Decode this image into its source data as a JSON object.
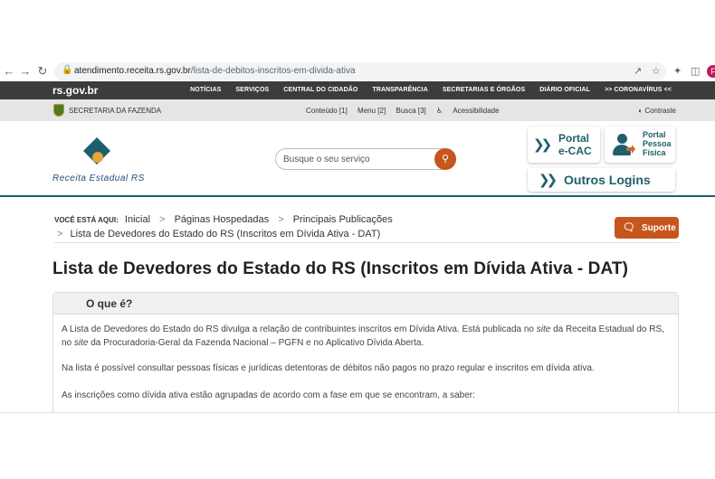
{
  "browser": {
    "back_icon": "←",
    "forward_icon": "→",
    "reload_icon": "↻",
    "url_domain": "atendimento.receita.rs.gov.br",
    "url_path": "/lista-de-debitos-inscritos-em-divida-ativa",
    "profile_letter": "F"
  },
  "topnav": {
    "logo": "rs.gov.br",
    "links": [
      "NOTÍCIAS",
      "SERVIÇOS",
      "CENTRAL DO CIDADÃO",
      "TRANSPARÊNCIA",
      "SECRETARIAS E ÓRGÃOS",
      "DIÁRIO OFICIAL",
      ">> CORONAVÍRUS <<"
    ]
  },
  "secbar": {
    "label": "SECRETARIA DA FAZENDA",
    "links": [
      "Conteúdo [1]",
      "Menu [2]",
      "Busca [3]",
      "Acessibilidade"
    ],
    "contrast": "Contraste"
  },
  "header": {
    "logo_text": "Receita Estadual RS",
    "search_placeholder": "Busque o seu serviço",
    "ecac_line1": "Portal",
    "ecac_line2": "e-CAC",
    "pf_line1": "Portal",
    "pf_line2": "Pessoa",
    "pf_line3": "Física",
    "outros": "Outros Logins",
    "brand_color": "#1f5f6b",
    "accent_color": "#c6561e"
  },
  "breadcrumb": {
    "label": "VOCÊ ESTÁ AQUI:",
    "items": [
      "Inicial",
      "Páginas Hospedadas",
      "Principais Publicações"
    ],
    "current": "Lista de Devedores do Estado do RS (Inscritos em Dívida Ativa - DAT)"
  },
  "suporte": {
    "label": "Suporte"
  },
  "page_title": "Lista de Devedores do Estado do RS (Inscritos em Dívida Ativa - DAT)",
  "panel": {
    "title": "O que é?",
    "p1_a": "A Lista de Devedores do Estado do RS divulga a relação de contribuintes inscritos em Dívida Ativa. Está publicada no ",
    "p1_site1": "site",
    "p1_b": " da Receita Estadual do RS,",
    "p1_c": "no ",
    "p1_site2": "site",
    "p1_d": " da Procuradoria-Geral da Fazenda Nacional – PGFN e no Aplicativo Dívida Aberta.",
    "p2": "Na lista é possível consultar pessoas  físicas e jurídicas detentoras de débitos não pagos no prazo regular e inscritos em dívida ativa.",
    "p3": "As inscrições como dívida ativa estão agrupadas de acordo com a fase em que se encontram, a saber:"
  }
}
